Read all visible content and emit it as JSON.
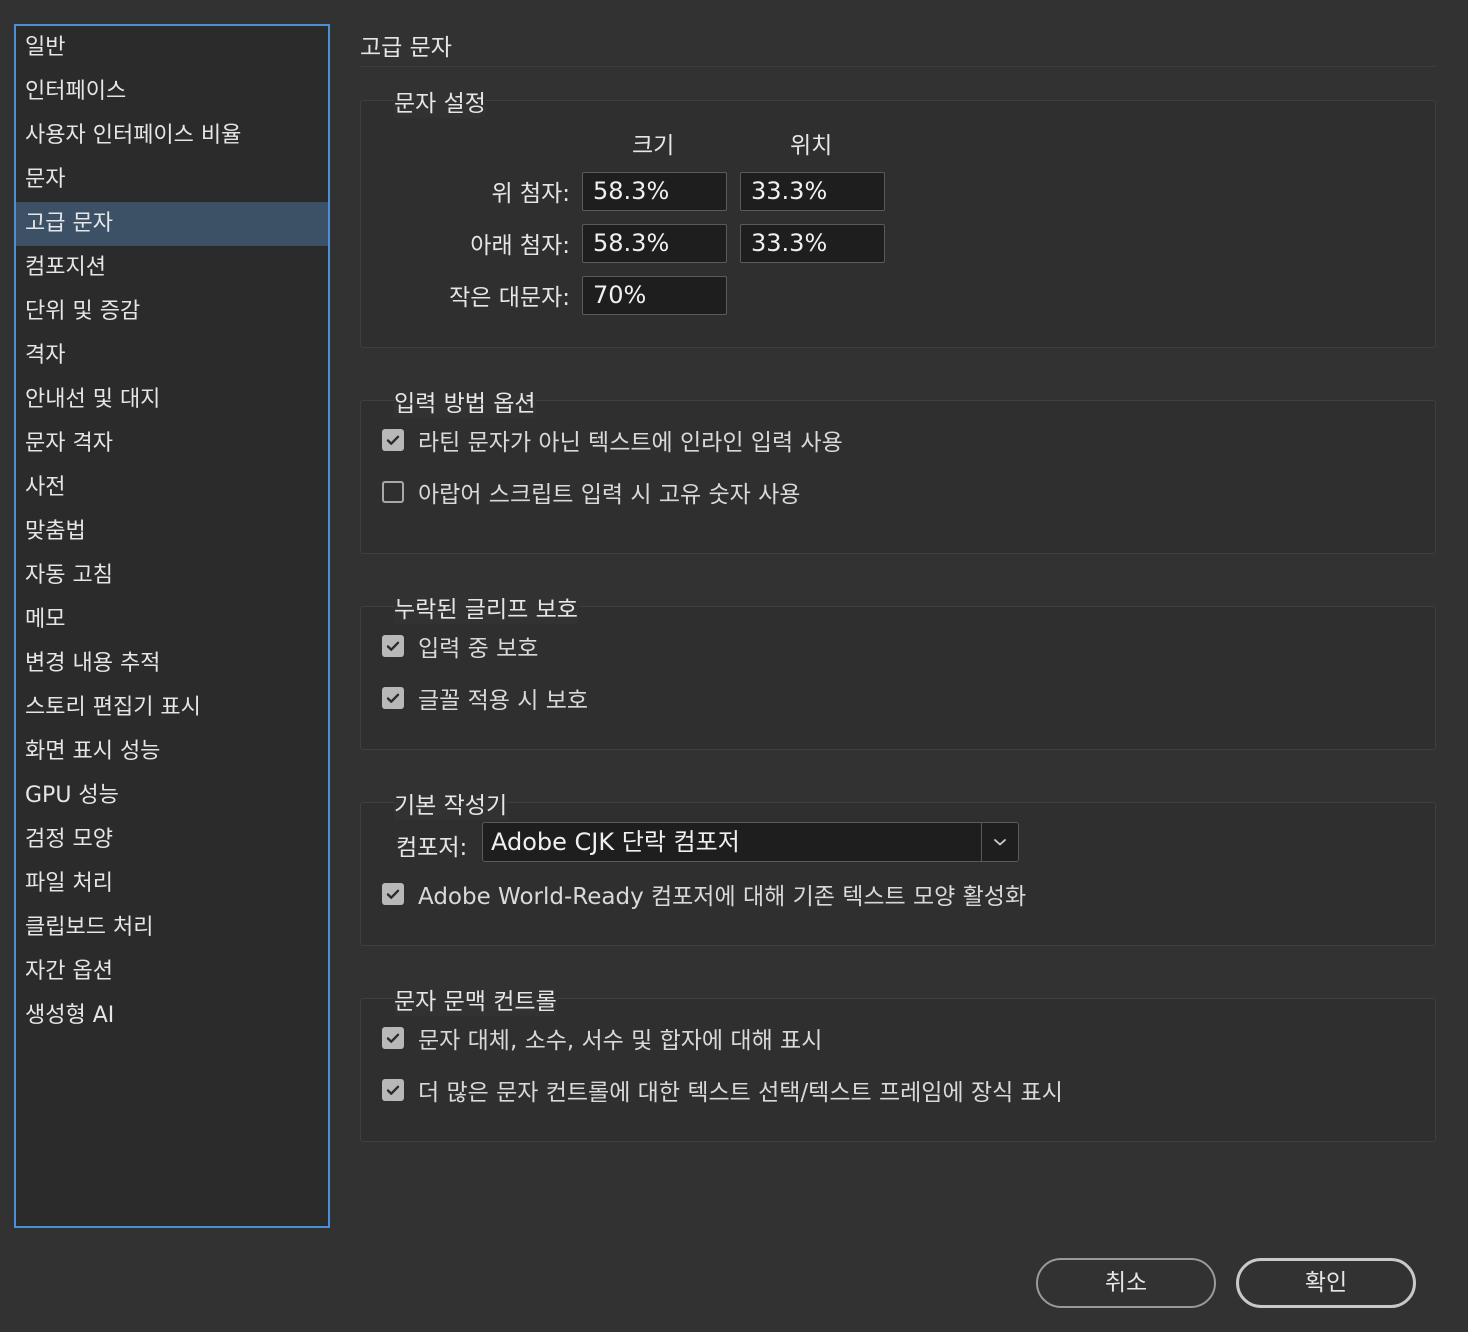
{
  "sidebar": {
    "items": [
      {
        "label": "일반"
      },
      {
        "label": "인터페이스"
      },
      {
        "label": "사용자 인터페이스 비율"
      },
      {
        "label": "문자"
      },
      {
        "label": "고급 문자"
      },
      {
        "label": "컴포지션"
      },
      {
        "label": "단위 및 증감"
      },
      {
        "label": "격자"
      },
      {
        "label": "안내선 및 대지"
      },
      {
        "label": "문자 격자"
      },
      {
        "label": "사전"
      },
      {
        "label": "맞춤법"
      },
      {
        "label": "자동 고침"
      },
      {
        "label": "메모"
      },
      {
        "label": "변경 내용 추적"
      },
      {
        "label": "스토리 편집기 표시"
      },
      {
        "label": "화면 표시 성능"
      },
      {
        "label": "GPU 성능"
      },
      {
        "label": "검정 모양"
      },
      {
        "label": "파일 처리"
      },
      {
        "label": "클립보드 처리"
      },
      {
        "label": "자간 옵션"
      },
      {
        "label": "생성형 AI"
      }
    ],
    "selected": "고급 문자"
  },
  "main": {
    "title": "고급 문자",
    "char_settings": {
      "title": "문자 설정",
      "col_size": "크기",
      "col_position": "위치",
      "superscript_label": "위 첨자:",
      "superscript_size": "58.3%",
      "superscript_position": "33.3%",
      "subscript_label": "아래 첨자:",
      "subscript_size": "58.3%",
      "subscript_position": "33.3%",
      "smallcaps_label": "작은 대문자:",
      "smallcaps_size": "70%"
    },
    "input_method": {
      "title": "입력 방법 옵션",
      "inline_input": {
        "label": "라틴 문자가 아닌 텍스트에 인라인 입력 사용",
        "checked": true
      },
      "native_digits": {
        "label": "아랍어 스크립트 입력 시 고유 숫자 사용",
        "checked": false
      }
    },
    "glyph_protection": {
      "title": "누락된 글리프 보호",
      "protect_typing": {
        "label": "입력 중 보호",
        "checked": true
      },
      "protect_font": {
        "label": "글꼴 적용 시 보호",
        "checked": true
      }
    },
    "default_composer": {
      "title": "기본 작성기",
      "composer_label": "컴포저:",
      "composer_value": "Adobe CJK 단락 컴포저",
      "world_ready": {
        "label": "Adobe World-Ready 컴포저에 대해 기존 텍스트 모양 활성화",
        "checked": true
      }
    },
    "contextual_controls": {
      "title": "문자 문맥 컨트롤",
      "show_alternates": {
        "label": "문자 대체, 소수, 서수 및 합자에 대해 표시",
        "checked": true
      },
      "show_more": {
        "label": "더 많은 문자 컨트롤에 대한 텍스트 선택/텍스트 프레임에 장식 표시",
        "checked": true
      }
    }
  },
  "buttons": {
    "cancel": "취소",
    "ok": "확인"
  },
  "colors": {
    "background": "#323232",
    "sidebar_border": "#4a90d9",
    "selected_item": "#3d5166"
  }
}
